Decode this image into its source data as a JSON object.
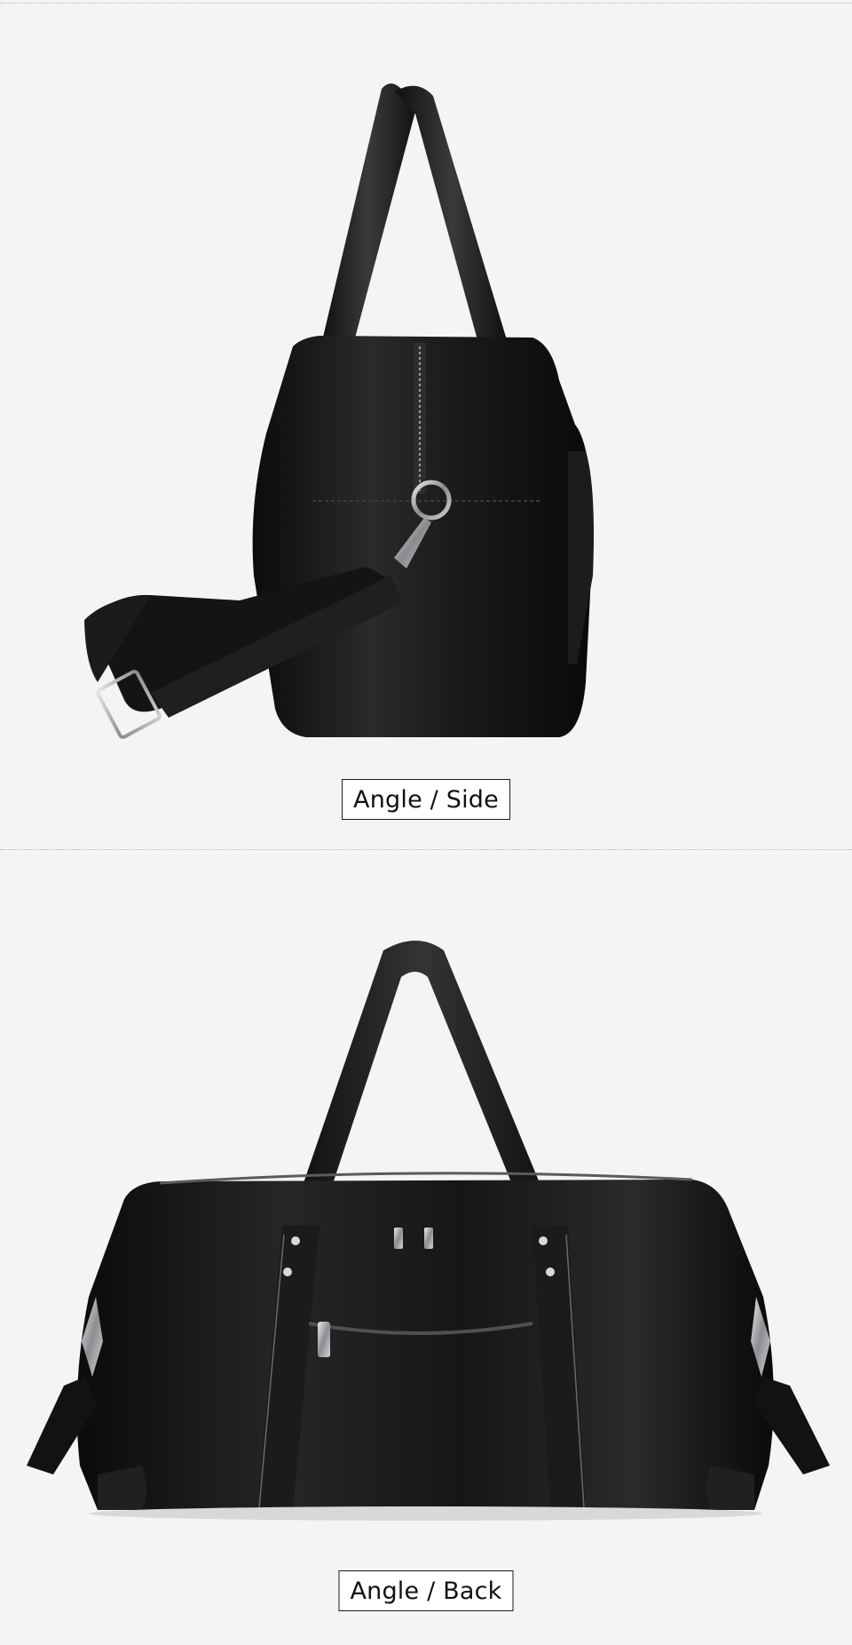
{
  "captions": {
    "side": "Angle / Side",
    "back": "Angle / Back"
  },
  "colors": {
    "background": "#f4f4f5",
    "leather": "#141415",
    "caption_border": "#1a1a1a"
  },
  "photos": {
    "side": {
      "subject": "black-leather-duffel-bag-side-view-icon"
    },
    "back": {
      "subject": "black-leather-duffel-bag-back-view-icon"
    }
  }
}
